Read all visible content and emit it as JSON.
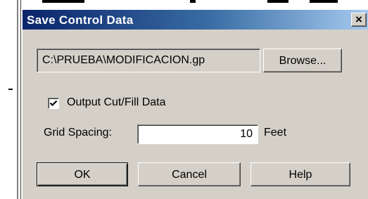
{
  "dialog": {
    "title": "Save Control Data",
    "close_label": "×"
  },
  "file": {
    "path_value": "C:\\PRUEBA\\MODIFICACION.gp",
    "browse_label": "Browse..."
  },
  "output_cutfill": {
    "checked": true,
    "label": "Output Cut/Fill Data"
  },
  "grid": {
    "label": "Grid Spacing:",
    "value": "10",
    "unit": "Feet"
  },
  "buttons": {
    "ok": "OK",
    "cancel": "Cancel",
    "help": "Help"
  },
  "colors": {
    "titlebar_start": "#0a246a",
    "titlebar_end": "#a6caf0",
    "face": "#d4d0c8"
  }
}
